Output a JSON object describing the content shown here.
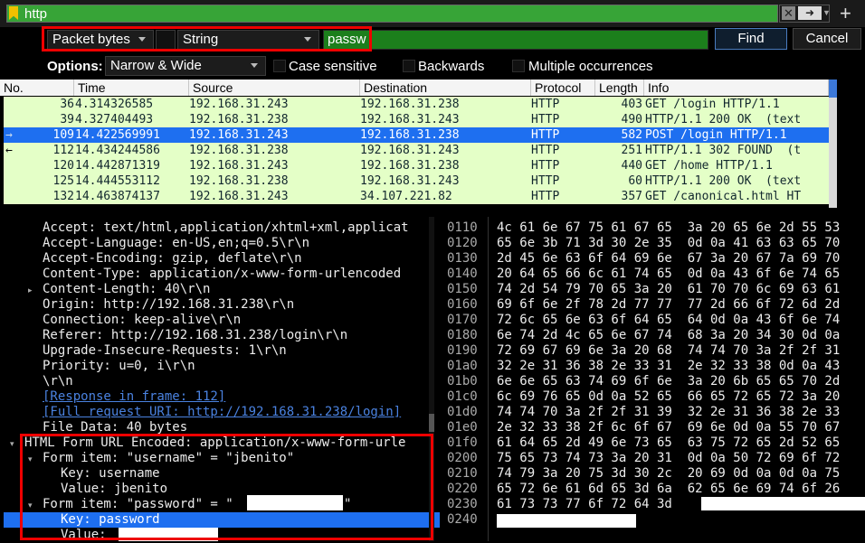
{
  "filter": {
    "value": "http",
    "clear_label": "✕",
    "apply_label": "➜"
  },
  "find": {
    "search_in": "Packet bytes",
    "search_type": "String",
    "search_value": "passw",
    "find_label": "Find",
    "cancel_label": "Cancel",
    "options_label": "Options:",
    "options_value": "Narrow & Wide",
    "case_sensitive": "Case sensitive",
    "backwards": "Backwards",
    "multiple": "Multiple occurrences"
  },
  "packet_list": {
    "columns": [
      "No.",
      "Time",
      "Source",
      "Destination",
      "Protocol",
      "Length",
      "Info"
    ],
    "rows": [
      {
        "no": "36",
        "time": "4.314326585",
        "src": "192.168.31.243",
        "dst": "192.168.31.238",
        "proto": "HTTP",
        "len": "403",
        "info": "GET /login HTTP/1.1"
      },
      {
        "no": "39",
        "time": "4.327404493",
        "src": "192.168.31.238",
        "dst": "192.168.31.243",
        "proto": "HTTP",
        "len": "490",
        "info": "HTTP/1.1 200 OK  (text"
      },
      {
        "no": "109",
        "time": "14.422569991",
        "src": "192.168.31.243",
        "dst": "192.168.31.238",
        "proto": "HTTP",
        "len": "582",
        "info": "POST /login HTTP/1.1"
      },
      {
        "no": "112",
        "time": "14.434244586",
        "src": "192.168.31.238",
        "dst": "192.168.31.243",
        "proto": "HTTP",
        "len": "251",
        "info": "HTTP/1.1 302 FOUND  (t"
      },
      {
        "no": "120",
        "time": "14.442871319",
        "src": "192.168.31.243",
        "dst": "192.168.31.238",
        "proto": "HTTP",
        "len": "440",
        "info": "GET /home HTTP/1.1"
      },
      {
        "no": "125",
        "time": "14.444553112",
        "src": "192.168.31.238",
        "dst": "192.168.31.243",
        "proto": "HTTP",
        "len": "60",
        "info": "HTTP/1.1 200 OK  (text"
      },
      {
        "no": "132",
        "time": "14.463874137",
        "src": "192.168.31.243",
        "dst": "34.107.221.82",
        "proto": "HTTP",
        "len": "357",
        "info": "GET /canonical.html HT"
      }
    ],
    "selected_index": 2
  },
  "details": {
    "lines": [
      "Accept: text/html,application/xhtml+xml,applicat",
      "Accept-Language: en-US,en;q=0.5\\r\\n",
      "Accept-Encoding: gzip, deflate\\r\\n",
      "Content-Type: application/x-www-form-urlencoded",
      "Content-Length: 40\\r\\n",
      "Origin: http://192.168.31.238\\r\\n",
      "Connection: keep-alive\\r\\n",
      "Referer: http://192.168.31.238/login\\r\\n",
      "Upgrade-Insecure-Requests: 1\\r\\n",
      "Priority: u=0, i\\r\\n",
      "\\r\\n",
      "[Response in frame: 112]",
      "[Full request URI: http://192.168.31.238/login]",
      "File Data: 40 bytes",
      "HTML Form URL Encoded: application/x-www-form-urle",
      "Form item: \"username\" = \"jbenito\"",
      "Key: username",
      "Value: jbenito",
      "Form item: \"password\" = \"",
      "Key: password",
      "Value: "
    ],
    "password_close_quote": "\""
  },
  "hex": {
    "offsets": [
      "0110",
      "0120",
      "0130",
      "0140",
      "0150",
      "0160",
      "0170",
      "0180",
      "0190",
      "01a0",
      "01b0",
      "01c0",
      "01d0",
      "01e0",
      "01f0",
      "0200",
      "0210",
      "0220",
      "0230",
      "0240"
    ],
    "bytes": [
      "4c 61 6e 67 75 61 67 65  3a 20 65 6e 2d 55 53",
      "65 6e 3b 71 3d 30 2e 35  0d 0a 41 63 63 65 70",
      "2d 45 6e 63 6f 64 69 6e  67 3a 20 67 7a 69 70",
      "20 64 65 66 6c 61 74 65  0d 0a 43 6f 6e 74 65",
      "74 2d 54 79 70 65 3a 20  61 70 70 6c 69 63 61",
      "69 6f 6e 2f 78 2d 77 77  77 2d 66 6f 72 6d 2d",
      "72 6c 65 6e 63 6f 64 65  64 0d 0a 43 6f 6e 74",
      "6e 74 2d 4c 65 6e 67 74  68 3a 20 34 30 0d 0a",
      "72 69 67 69 6e 3a 20 68  74 74 70 3a 2f 2f 31",
      "32 2e 31 36 38 2e 33 31  2e 32 33 38 0d 0a 43",
      "6e 6e 65 63 74 69 6f 6e  3a 20 6b 65 65 70 2d",
      "6c 69 76 65 0d 0a 52 65  66 65 72 65 72 3a 20",
      "74 74 70 3a 2f 2f 31 39  32 2e 31 36 38 2e 33",
      "2e 32 33 38 2f 6c 6f 67  69 6e 0d 0a 55 70 67",
      "61 64 65 2d 49 6e 73 65  63 75 72 65 2d 52 65",
      "75 65 73 74 73 3a 20 31  0d 0a 50 72 69 6f 72",
      "74 79 3a 20 75 3d 30 2c  20 69 0d 0a 0d 0a 75",
      "65 72 6e 61 6d 65 3d 6a  62 65 6e 69 74 6f 26",
      "61 73 73 77 6f 72 64 3d",
      ""
    ]
  }
}
